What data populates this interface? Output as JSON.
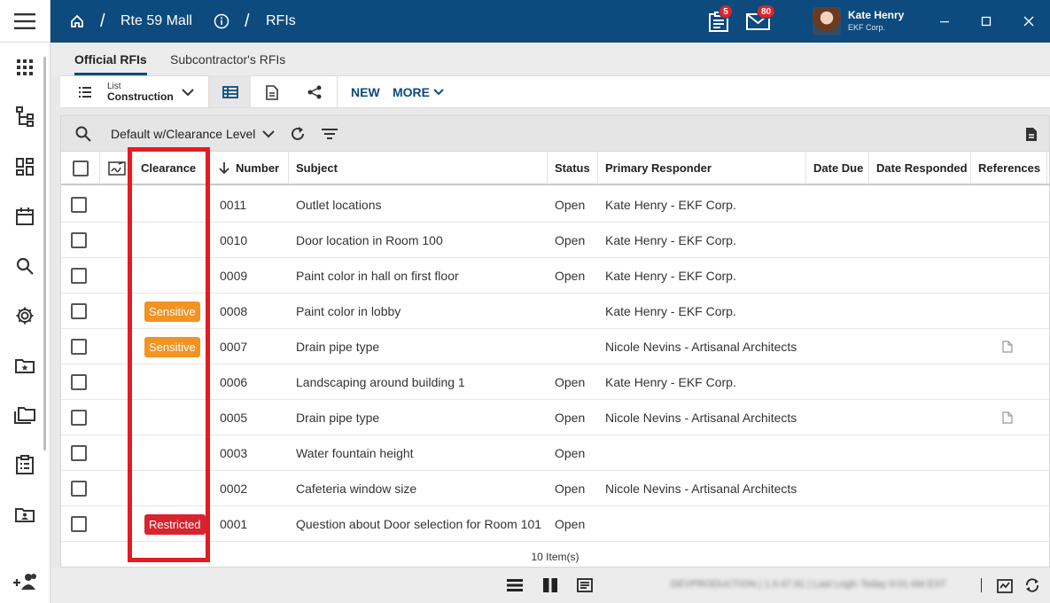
{
  "header": {
    "project": "Rte 59 Mall",
    "module": "RFIs",
    "tasks_badge": "5",
    "mail_badge": "80",
    "user_name": "Kate Henry",
    "user_org": "EKF Corp."
  },
  "tabs": [
    "Official RFIs",
    "Subcontractor's RFIs"
  ],
  "toolbar": {
    "list_label": "List",
    "list_value": "Construction",
    "new_label": "NEW",
    "more_label": "MORE"
  },
  "filter": {
    "view_name": "Default w/Clearance Level"
  },
  "columns": {
    "clearance": "Clearance",
    "number": "Number",
    "subject": "Subject",
    "status": "Status",
    "primary_responder": "Primary Responder",
    "date_due": "Date Due",
    "date_responded": "Date Responded",
    "references": "References"
  },
  "rows": [
    {
      "clearance": "",
      "number": "0011",
      "subject": "Outlet locations",
      "status": "Open",
      "responder": "Kate Henry - EKF Corp.",
      "ref": false
    },
    {
      "clearance": "",
      "number": "0010",
      "subject": "Door location in Room 100",
      "status": "Open",
      "responder": "Kate Henry - EKF Corp.",
      "ref": false
    },
    {
      "clearance": "",
      "number": "0009",
      "subject": "Paint color in hall on first floor",
      "status": "Open",
      "responder": "Kate Henry - EKF Corp.",
      "ref": false
    },
    {
      "clearance": "Sensitive",
      "number": "0008",
      "subject": "Paint color in lobby",
      "status": "",
      "responder": "Kate Henry - EKF Corp.",
      "ref": false
    },
    {
      "clearance": "Sensitive",
      "number": "0007",
      "subject": "Drain pipe type",
      "status": "",
      "responder": "Nicole Nevins - Artisanal Architects",
      "ref": true
    },
    {
      "clearance": "",
      "number": "0006",
      "subject": "Landscaping around building 1",
      "status": "Open",
      "responder": "Kate Henry - EKF Corp.",
      "ref": false
    },
    {
      "clearance": "",
      "number": "0005",
      "subject": "Drain pipe type",
      "status": "Open",
      "responder": "Nicole Nevins - Artisanal Architects",
      "ref": true
    },
    {
      "clearance": "",
      "number": "0003",
      "subject": "Water fountain height",
      "status": "Open",
      "responder": "",
      "ref": false
    },
    {
      "clearance": "",
      "number": "0002",
      "subject": "Cafeteria window size",
      "status": "Open",
      "responder": "Nicole Nevins - Artisanal Architects",
      "ref": false
    },
    {
      "clearance": "Restricted",
      "number": "0001",
      "subject": "Question about Door selection for Room 101",
      "status": "Open",
      "responder": "",
      "ref": false
    }
  ],
  "item_count": "10 Item(s)",
  "status_bar": {
    "blurred_text": "DEVPRODUCTION | 1.9.47.91 | Last Login Today 9:01 AM EST"
  },
  "colors": {
    "header": "#0d4a7d",
    "sensitive": "#f29322",
    "restricted": "#d8242e",
    "highlight": "#e31b23"
  }
}
